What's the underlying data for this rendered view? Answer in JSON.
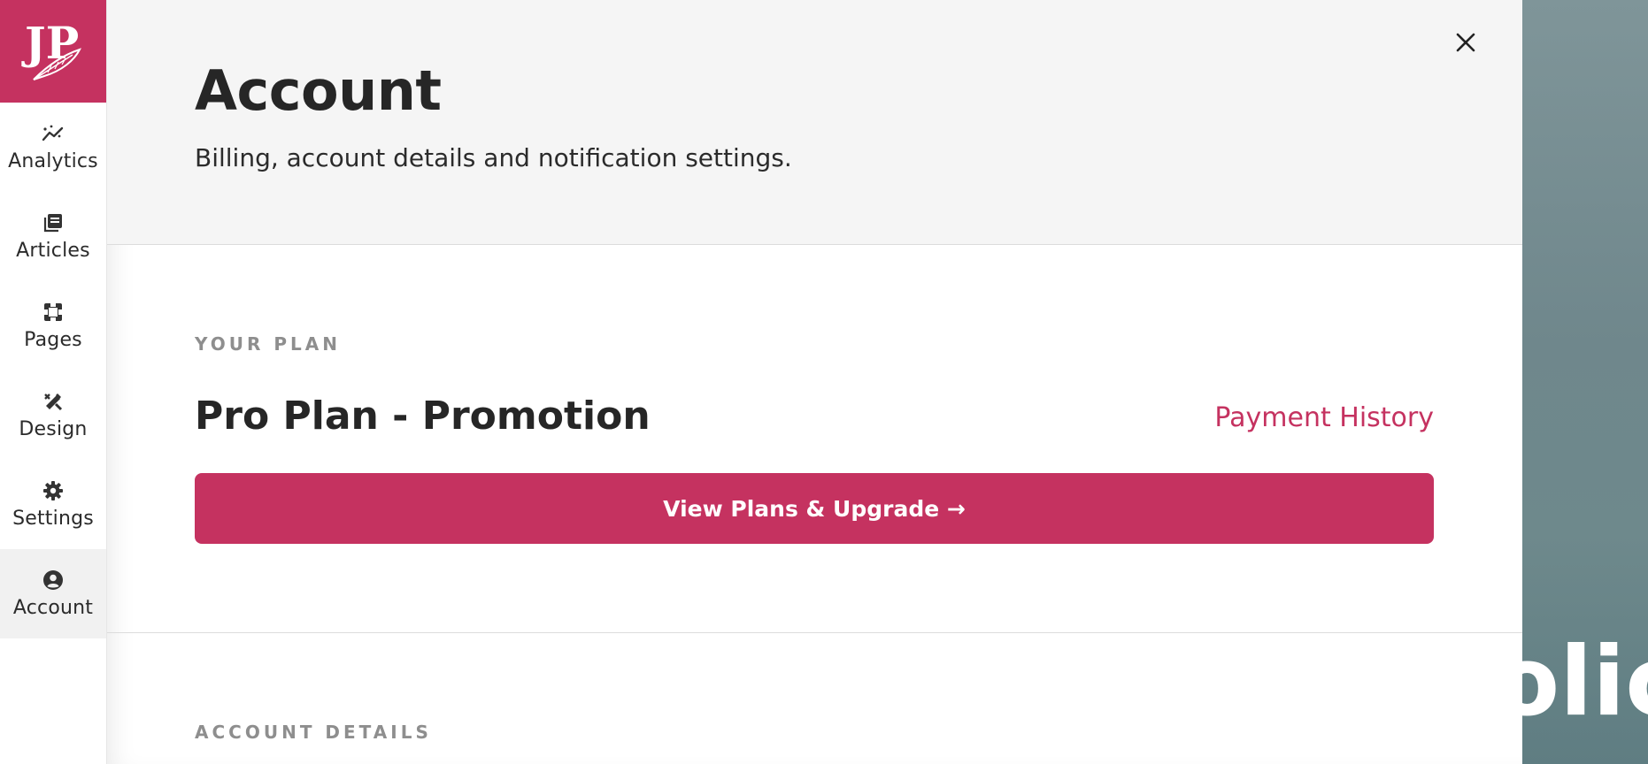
{
  "sidebar": {
    "logo_text": "JP",
    "items": [
      {
        "label": "Analytics",
        "icon": "analytics-icon"
      },
      {
        "label": "Articles",
        "icon": "articles-icon"
      },
      {
        "label": "Pages",
        "icon": "pages-icon"
      },
      {
        "label": "Design",
        "icon": "design-icon"
      },
      {
        "label": "Settings",
        "icon": "gear-icon"
      },
      {
        "label": "Account",
        "icon": "account-icon",
        "active": true
      }
    ]
  },
  "header": {
    "title": "Account",
    "subtitle": "Billing, account details and notification settings."
  },
  "plan": {
    "section_label": "YOUR PLAN",
    "plan_name": "Pro Plan - Promotion",
    "payment_history_label": "Payment History",
    "upgrade_button_label": "View Plans & Upgrade →"
  },
  "account_details": {
    "section_label": "ACCOUNT DETAILS"
  },
  "background": {
    "partial_text": "olic"
  },
  "colors": {
    "accent": "#c53260",
    "header_bg": "#f5f5f5",
    "section_label": "#8e8e8e"
  }
}
